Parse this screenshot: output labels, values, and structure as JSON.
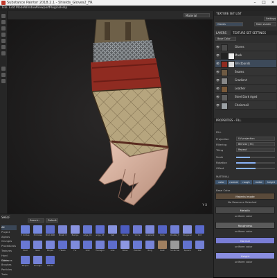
{
  "window": {
    "title": "Substance Painter 2018.2.1 - Shields_Gloves2_FR",
    "minimize": "–",
    "maximize": "□",
    "close": "✕"
  },
  "menu": [
    "File",
    "Edit",
    "Mode",
    "Window",
    "Viewport",
    "Plugins",
    "Help"
  ],
  "viewport": {
    "display_mode": "Material",
    "axis_label": "Y  X"
  },
  "texture_set_list": {
    "title": "TEXTURE SET LIST",
    "settings_label": "Settings",
    "set_name": "Gloves",
    "shader": "Main shader"
  },
  "layers_panel": {
    "tabs": [
      "LAYERS",
      "TEXTURE SET SETTINGS"
    ],
    "blend_mode": "Base Color",
    "layers": [
      {
        "name": "Gloves",
        "selected": false
      },
      {
        "name": "Mask",
        "selected": false
      },
      {
        "name": "Wristbands",
        "selected": true
      },
      {
        "name": "Seams",
        "selected": false
      },
      {
        "name": "Gradient",
        "selected": false
      },
      {
        "name": "Leather",
        "selected": false
      },
      {
        "name": "Steel Dark Aged",
        "selected": false
      },
      {
        "name": "Chainmail",
        "selected": false
      }
    ]
  },
  "properties": {
    "title": "PROPERTIES - FILL",
    "fill_label": "FILL",
    "projection_label": "Projection",
    "projection_value": "UV projection",
    "filtering_label": "Filtering",
    "filtering_value": "Bilinear | HQ",
    "tiling_label": "Tiling",
    "tiling_value": "Repeat",
    "scale_label": "Scale",
    "rotation_label": "Rotation",
    "offset_label": "Offset",
    "scale_fill": 0.35,
    "rotation_fill": 0.5,
    "offset_fill": 0.5
  },
  "material": {
    "title": "MATERIAL",
    "channels": [
      "color",
      "normal",
      "rough",
      "metal",
      "height"
    ],
    "base_color_label": "Base Color",
    "material_mode": "Material mode",
    "material_mode_sub": "No Resource Selected",
    "metallic_label": "Metallic",
    "metallic_sub": "uniform color",
    "roughness_label": "Roughness",
    "roughness_sub": "uniform color",
    "normal_label": "Normal",
    "normal_sub": "uniform color",
    "height_label": "Height",
    "height_sub": "uniform color"
  },
  "shelf": {
    "title": "SHELF",
    "search_placeholder": "Search...",
    "filter_label": "Default",
    "categories": [
      "All",
      "Project",
      "Alphas",
      "Grunges",
      "Procedurals",
      "Textures",
      "Hard Surfaces",
      "Filters",
      "Brushes",
      "Particles",
      "Tools"
    ],
    "tiles": [
      {
        "label": "3 Circles",
        "color": "#6b7fd8"
      },
      {
        "label": "3 Circles",
        "color": "#7689e0"
      },
      {
        "label": "Brick Pattern",
        "color": "#5d6dc9"
      },
      {
        "label": "Brush 3",
        "color": "#7b86d6"
      },
      {
        "label": "Bumps",
        "color": "#8a94e0"
      },
      {
        "label": "edge_01",
        "color": "#6677d0"
      },
      {
        "label": "edge_03",
        "color": "#5f6ed0"
      },
      {
        "label": "Cell",
        "color": "#8793df"
      },
      {
        "label": "Clouds",
        "color": "#4c5cc0"
      },
      {
        "label": "Circle",
        "color": "#6f7bd3"
      },
      {
        "label": "Gradient",
        "color": "#7c88da"
      },
      {
        "label": "Dots",
        "color": "#5564c6"
      },
      {
        "label": "Double_Heart",
        "color": "#717fd6"
      },
      {
        "label": "Diagonal",
        "color": "#8590dd"
      },
      {
        "label": "Dirt",
        "color": "#5a6acd"
      },
      {
        "label": "Dust",
        "color": "#6978d3"
      },
      {
        "label": "Gear",
        "color": "#7885d8"
      },
      {
        "label": "Ellipse",
        "color": "#7a86da"
      },
      {
        "label": "Fibers",
        "color": "#6170ce"
      },
      {
        "label": "Fur",
        "color": "#7e8bdc"
      },
      {
        "label": "Grid",
        "color": "#6474cf"
      },
      {
        "label": "Hexagon",
        "color": "#7481d6"
      },
      {
        "label": "Line",
        "color": "#5e6dcc"
      },
      {
        "label": "Noise",
        "color": "#8d97e2"
      },
      {
        "label": "Pointed",
        "color": "#6979d2"
      },
      {
        "label": "Ring",
        "color": "#7784d8"
      },
      {
        "label": "Rust",
        "color": "#a08060"
      },
      {
        "label": "Scratches",
        "color": "#9a9a9a"
      },
      {
        "label": "Square",
        "color": "#6272cf"
      },
      {
        "label": "Star",
        "color": "#7380d5"
      },
      {
        "label": "Stripes",
        "color": "#6a79d2"
      },
      {
        "label": "Triangle",
        "color": "#7582d7"
      },
      {
        "label": "Waves",
        "color": "#5f6ecd"
      }
    ]
  }
}
